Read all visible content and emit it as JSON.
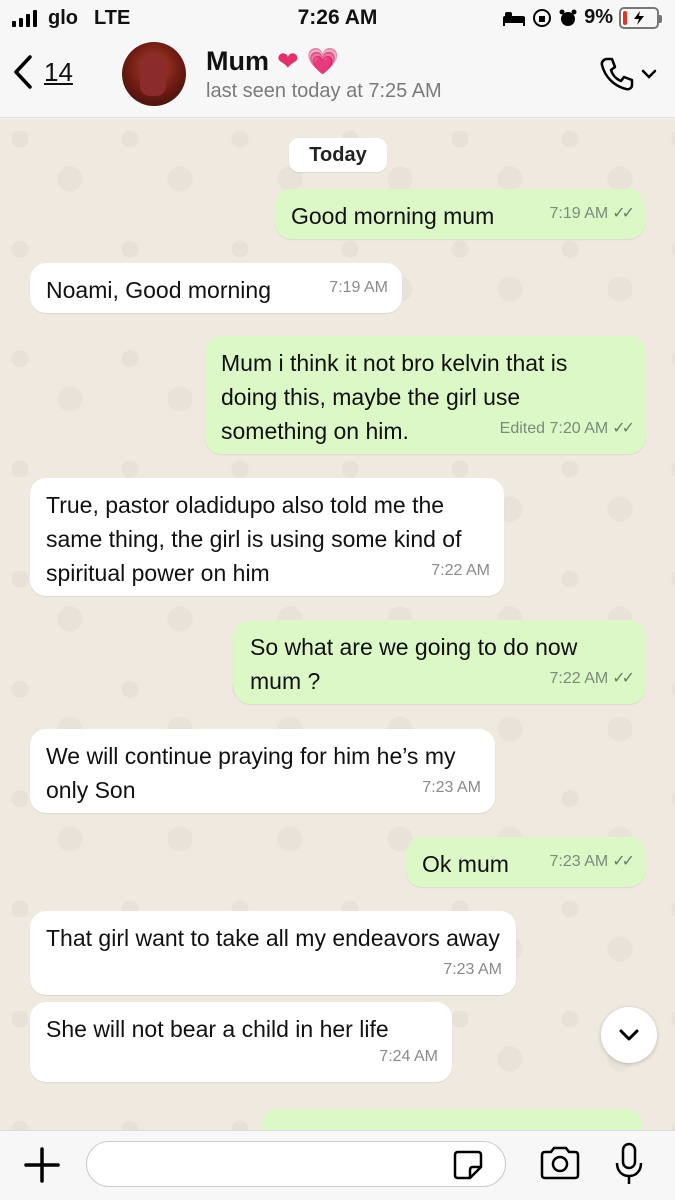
{
  "status_bar": {
    "carrier": "glo",
    "network": "LTE",
    "time": "7:26 AM",
    "battery": "9%",
    "battery_level": 0.09
  },
  "header": {
    "back_count": "14",
    "contact_name": "Mum",
    "last_seen": "last seen today at 7:25 AM"
  },
  "chat": {
    "date_label": "Today",
    "messages": [
      {
        "dir": "out",
        "text": "Good morning mum",
        "time": "7:19 AM"
      },
      {
        "dir": "in",
        "text": "Noami, Good morning",
        "time": "7:19 AM"
      },
      {
        "dir": "out",
        "text": "Mum i think it not bro kelvin that is doing this, maybe the girl use something on him.",
        "time": "Edited 7:20 AM"
      },
      {
        "dir": "in",
        "text": "True, pastor oladidupo also told me the same thing, the girl is using some kind of spiritual power on him",
        "time": "7:22 AM"
      },
      {
        "dir": "out",
        "text": "So what are we going to do now mum ?",
        "time": "7:22 AM"
      },
      {
        "dir": "in",
        "text": "We will continue praying for him he’s my only Son",
        "time": "7:23 AM"
      },
      {
        "dir": "out",
        "text": "Ok mum",
        "time": "7:23 AM"
      },
      {
        "dir": "in",
        "text": "That girl want to take all my endeavors away",
        "time": "7:23 AM"
      },
      {
        "dir": "in",
        "text": "She will not bear a child in her life",
        "time": "7:24 AM"
      }
    ]
  },
  "input": {
    "placeholder": ""
  },
  "icons": {
    "back": "chevron-left-icon",
    "call": "phone-icon",
    "plus": "plus-icon",
    "sticker": "sticker-icon",
    "camera": "camera-icon",
    "mic": "microphone-icon",
    "scroll": "chevron-down-icon"
  },
  "colors": {
    "outgoing_bubble": "#dcf8c6",
    "incoming_bubble": "#ffffff",
    "chat_background": "#efe9df",
    "battery_low": "#e0362d"
  }
}
